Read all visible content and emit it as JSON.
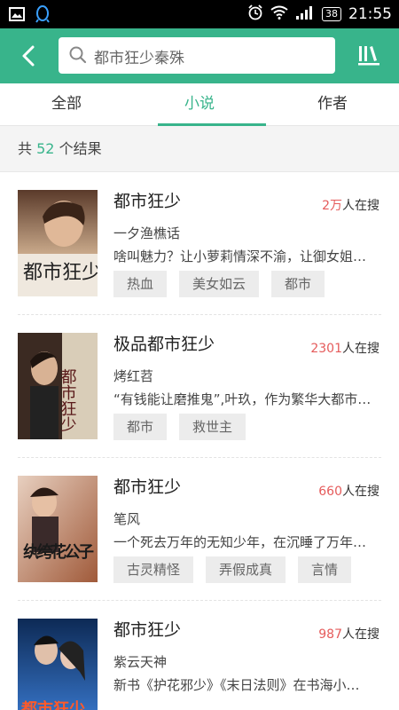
{
  "status_bar": {
    "time": "21:55",
    "battery": "38"
  },
  "header": {
    "search_value": "都市狂少秦殊"
  },
  "tabs": [
    {
      "label": "全部",
      "active": false
    },
    {
      "label": "小说",
      "active": true
    },
    {
      "label": "作者",
      "active": false
    }
  ],
  "results": {
    "prefix": "共",
    "count": "52",
    "suffix": "个结果"
  },
  "books": [
    {
      "title": "都市狂少",
      "searches": "2万",
      "searches_suffix": "人在搜",
      "author": "一夕渔樵话",
      "description": "啥叫魅力？让小萝莉情深不渝，让御女姐…",
      "tags": [
        "热血",
        "美女如云",
        "都市"
      ],
      "cover_text": "都市狂少"
    },
    {
      "title": "极品都市狂少",
      "searches": "2301",
      "searches_suffix": "人在搜",
      "author": "烤红苕",
      "description": "“有钱能让磨推鬼”,叶玖，作为繁华大都市…",
      "tags": [
        "都市",
        "救世主"
      ],
      "cover_text": "都市狂少"
    },
    {
      "title": "都市狂少",
      "searches": "660",
      "searches_suffix": "人在搜",
      "author": "笔风",
      "description": "一个死去万年的无知少年，在沉睡了万年…",
      "tags": [
        "古灵精怪",
        "弄假成真",
        "言情"
      ],
      "cover_text": "纨绔花公子"
    },
    {
      "title": "都市狂少",
      "searches": "987",
      "searches_suffix": "人在搜",
      "author": "紫云天神",
      "description": "新书《护花邪少》《末日法则》在书海小…",
      "tags": [],
      "cover_text": "都市狂少"
    }
  ]
}
